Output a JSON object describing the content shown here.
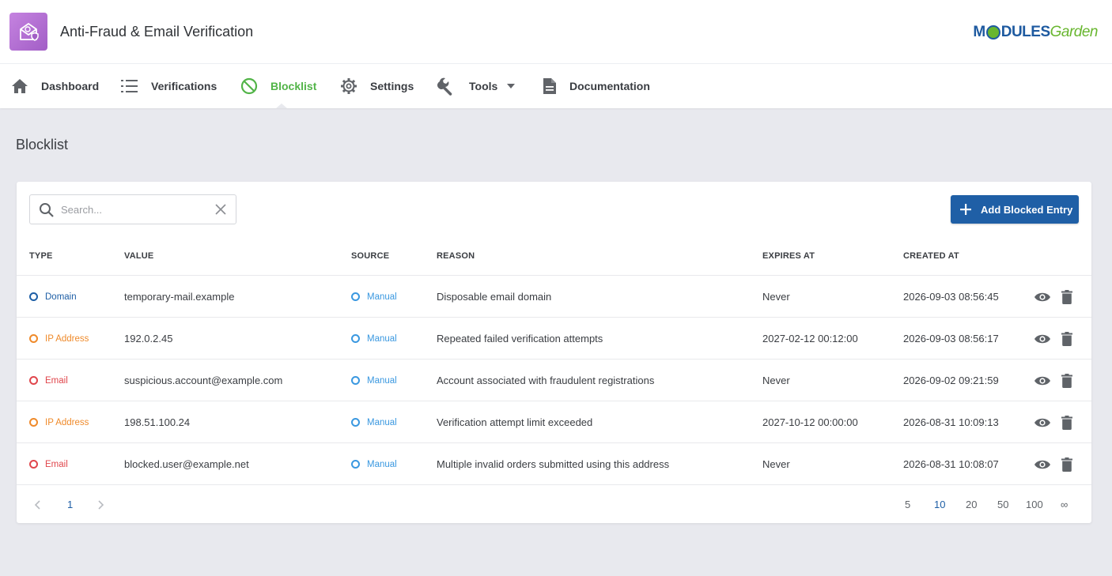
{
  "header": {
    "app_title": "Anti-Fraud & Email Verification",
    "brand_part1": "M",
    "brand_part2": "DULES",
    "brand_part3": "Garden",
    "brand_colors": {
      "blue": "#1e5aa0",
      "green": "#68b62f"
    }
  },
  "nav": {
    "items": [
      {
        "label": "Dashboard",
        "icon": "home-icon"
      },
      {
        "label": "Verifications",
        "icon": "list-icon"
      },
      {
        "label": "Blocklist",
        "icon": "block-icon",
        "active": true
      },
      {
        "label": "Settings",
        "icon": "gear-icon"
      },
      {
        "label": "Tools",
        "icon": "wrench-icon",
        "dropdown": true
      },
      {
        "label": "Documentation",
        "icon": "document-icon"
      }
    ],
    "active_color": "#52b448"
  },
  "page": {
    "title": "Blocklist"
  },
  "search": {
    "placeholder": "Search...",
    "value": ""
  },
  "toolbar": {
    "add_label": "Add Blocked Entry",
    "button_color": "#1f5fa6"
  },
  "table": {
    "columns": [
      "TYPE",
      "VALUE",
      "SOURCE",
      "REASON",
      "EXPIRES AT",
      "CREATED AT"
    ],
    "rows": [
      {
        "type": "Domain",
        "type_color": "#1f5fa6",
        "value": "temporary-mail.example",
        "source": "Manual",
        "reason": "Disposable email domain",
        "expires": "Never",
        "created": "2026-09-03 08:56:45"
      },
      {
        "type": "IP Address",
        "type_color": "#ef8a2a",
        "value": "192.0.2.45",
        "source": "Manual",
        "reason": "Repeated failed verification attempts",
        "expires": "2027-02-12 00:12:00",
        "created": "2026-09-03 08:56:17"
      },
      {
        "type": "Email",
        "type_color": "#e0464c",
        "value": "suspicious.account@example.com",
        "source": "Manual",
        "reason": "Account associated with fraudulent registrations",
        "expires": "Never",
        "created": "2026-09-02 09:21:59"
      },
      {
        "type": "IP Address",
        "type_color": "#ef8a2a",
        "value": "198.51.100.24",
        "source": "Manual",
        "reason": "Verification attempt limit exceeded",
        "expires": "2027-10-12 00:00:00",
        "created": "2026-08-31 10:09:13"
      },
      {
        "type": "Email",
        "type_color": "#e0464c",
        "value": "blocked.user@example.net",
        "source": "Manual",
        "reason": "Multiple invalid orders submitted using this address",
        "expires": "Never",
        "created": "2026-08-31 10:08:07"
      }
    ],
    "source_color": "#3a98e0"
  },
  "pagination": {
    "pages": [
      "1"
    ],
    "current_page": "1",
    "page_sizes": [
      "5",
      "10",
      "20",
      "50",
      "100",
      "∞"
    ],
    "current_size": "10"
  }
}
